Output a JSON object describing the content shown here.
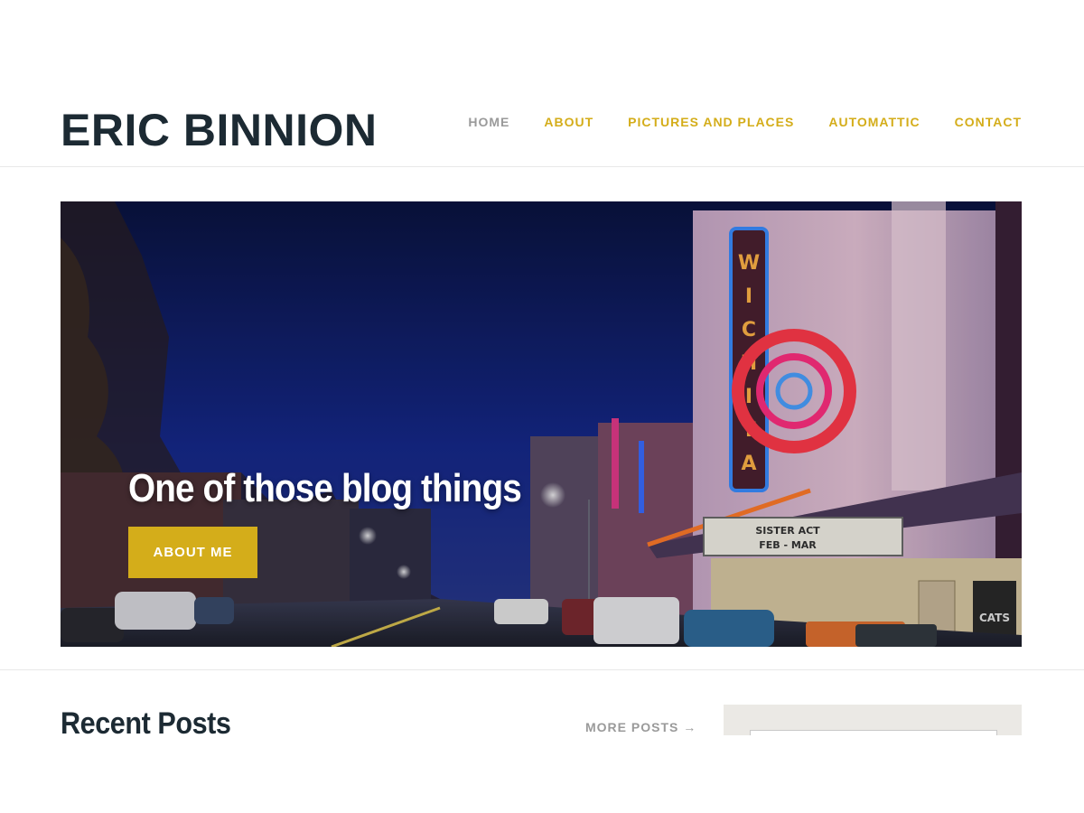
{
  "site": {
    "title": "ERIC BINNION"
  },
  "nav": {
    "items": [
      {
        "label": "HOME",
        "current": true
      },
      {
        "label": "ABOUT",
        "current": false
      },
      {
        "label": "PICTURES AND PLACES",
        "current": false
      },
      {
        "label": "AUTOMATTIC",
        "current": false
      },
      {
        "label": "CONTACT",
        "current": false
      }
    ]
  },
  "hero": {
    "heading": "One of those blog things",
    "button_label": "ABOUT ME",
    "sign_letters": "WICHITA",
    "marquee_line1": "SISTER ACT",
    "marquee_line2": "FEB - MAR",
    "poster_text": "CATS"
  },
  "recent": {
    "title": "Recent Posts",
    "more_label": "MORE POSTS →"
  },
  "colors": {
    "accent": "#d4ad1a",
    "heading": "#1c2a33",
    "muted": "#9a9a9a",
    "sidebar_bg": "#ebe9e5"
  }
}
